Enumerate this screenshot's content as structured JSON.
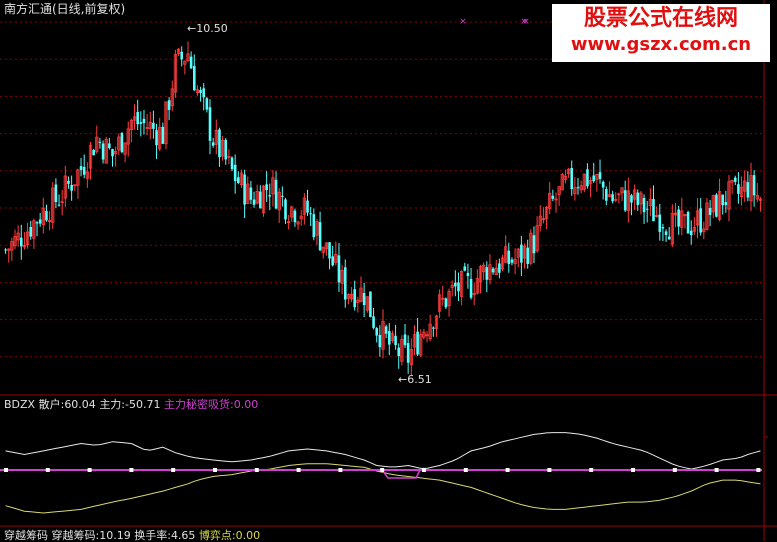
{
  "title": "南方汇通(日线,前复权)",
  "watermark": {
    "line1": "股票公式在线网",
    "line2": "www.gszx.com.cn"
  },
  "price_annotations": {
    "high": "10.50",
    "low": "6.51"
  },
  "indicator": {
    "name": "BDZX",
    "sanhu_label": "散户:",
    "sanhu_value": "60.04",
    "zhuli_label": "主力:",
    "zhuli_value": "-50.71",
    "secret_label": "主力秘密吸货:",
    "secret_value": "0.00"
  },
  "bottom": {
    "item1": "穿越筹码",
    "item2_label": "穿越筹码:",
    "item2_value": "10.19",
    "turnover_label": "换手率:",
    "turnover_value": "4.65",
    "game_label": "博弈点:",
    "game_value": "0.00"
  },
  "colors": {
    "up": "#ff3c3c",
    "down": "#54ffff",
    "white_line": "#e8e8e8",
    "yellow_line": "#d8d870",
    "purple": "#d040d0",
    "grid": "#8b0000",
    "pane_border": "#a00000"
  },
  "chart_data": {
    "type": "candlestick",
    "ylim": [
      6.3,
      10.65
    ],
    "high_marker": 10.5,
    "low_marker": 6.51,
    "close_path": [
      [
        0,
        7.95
      ],
      [
        6,
        8.15
      ],
      [
        12,
        8.4
      ],
      [
        18,
        8.6
      ],
      [
        24,
        8.9
      ],
      [
        29,
        9.25
      ],
      [
        34,
        9.05
      ],
      [
        40,
        9.45
      ],
      [
        45,
        9.4
      ],
      [
        50,
        9.3
      ],
      [
        54,
        10.1
      ],
      [
        58,
        10.25
      ],
      [
        61,
        9.8
      ],
      [
        66,
        9.25
      ],
      [
        72,
        8.85
      ],
      [
        78,
        8.55
      ],
      [
        84,
        8.7
      ],
      [
        90,
        8.45
      ],
      [
        96,
        8.4
      ],
      [
        102,
        7.95
      ],
      [
        108,
        7.5
      ],
      [
        114,
        7.45
      ],
      [
        118,
        7.05
      ],
      [
        123,
        6.8
      ],
      [
        128,
        6.7
      ],
      [
        133,
        7.05
      ],
      [
        138,
        7.3
      ],
      [
        143,
        7.5
      ],
      [
        148,
        7.55
      ],
      [
        153,
        7.75
      ],
      [
        158,
        7.8
      ],
      [
        163,
        7.85
      ],
      [
        168,
        8.05
      ],
      [
        173,
        8.45
      ],
      [
        178,
        8.7
      ],
      [
        183,
        8.8
      ],
      [
        188,
        8.75
      ],
      [
        193,
        8.55
      ],
      [
        198,
        8.55
      ],
      [
        203,
        8.45
      ],
      [
        208,
        8.35
      ],
      [
        213,
        8.2
      ],
      [
        218,
        8.25
      ],
      [
        223,
        8.35
      ],
      [
        228,
        8.55
      ],
      [
        233,
        8.6
      ],
      [
        236,
        8.7
      ],
      [
        240,
        8.55
      ]
    ],
    "white_line_range": [
      20,
      90
    ],
    "white_path": [
      [
        0,
        60
      ],
      [
        6,
        58
      ],
      [
        12,
        60
      ],
      [
        18,
        62
      ],
      [
        24,
        64
      ],
      [
        29,
        63
      ],
      [
        34,
        65
      ],
      [
        40,
        64
      ],
      [
        45,
        60
      ],
      [
        50,
        62
      ],
      [
        54,
        59
      ],
      [
        58,
        57
      ],
      [
        61,
        56
      ],
      [
        66,
        55
      ],
      [
        72,
        54
      ],
      [
        78,
        55
      ],
      [
        84,
        57
      ],
      [
        90,
        60
      ],
      [
        96,
        61
      ],
      [
        102,
        60
      ],
      [
        108,
        58
      ],
      [
        114,
        55
      ],
      [
        118,
        52
      ],
      [
        123,
        51
      ],
      [
        128,
        52
      ],
      [
        133,
        50
      ],
      [
        138,
        52
      ],
      [
        143,
        55
      ],
      [
        148,
        60
      ],
      [
        153,
        62
      ],
      [
        158,
        65
      ],
      [
        163,
        67
      ],
      [
        168,
        69
      ],
      [
        173,
        70
      ],
      [
        178,
        70
      ],
      [
        183,
        69
      ],
      [
        188,
        67
      ],
      [
        193,
        64
      ],
      [
        198,
        62
      ],
      [
        203,
        60
      ],
      [
        208,
        56
      ],
      [
        213,
        52
      ],
      [
        218,
        50
      ],
      [
        223,
        52
      ],
      [
        228,
        55
      ],
      [
        233,
        56
      ],
      [
        236,
        58
      ],
      [
        240,
        60
      ]
    ],
    "yellow_path": [
      [
        0,
        30
      ],
      [
        6,
        27
      ],
      [
        12,
        26
      ],
      [
        18,
        27
      ],
      [
        24,
        28
      ],
      [
        29,
        30
      ],
      [
        34,
        32
      ],
      [
        40,
        34
      ],
      [
        45,
        36
      ],
      [
        50,
        38
      ],
      [
        54,
        40
      ],
      [
        58,
        42
      ],
      [
        61,
        44
      ],
      [
        66,
        46
      ],
      [
        72,
        47
      ],
      [
        78,
        49
      ],
      [
        84,
        50
      ],
      [
        90,
        52
      ],
      [
        96,
        53
      ],
      [
        102,
        53
      ],
      [
        108,
        52
      ],
      [
        114,
        51
      ],
      [
        118,
        49
      ],
      [
        123,
        47
      ],
      [
        128,
        46
      ],
      [
        133,
        45
      ],
      [
        138,
        44
      ],
      [
        143,
        42
      ],
      [
        148,
        40
      ],
      [
        153,
        37
      ],
      [
        158,
        34
      ],
      [
        163,
        31
      ],
      [
        168,
        29
      ],
      [
        173,
        28
      ],
      [
        178,
        28
      ],
      [
        183,
        29
      ],
      [
        188,
        30
      ],
      [
        193,
        31
      ],
      [
        198,
        32
      ],
      [
        203,
        32
      ],
      [
        208,
        33
      ],
      [
        213,
        35
      ],
      [
        218,
        38
      ],
      [
        223,
        42
      ],
      [
        228,
        44
      ],
      [
        233,
        44
      ],
      [
        236,
        43
      ],
      [
        240,
        42
      ]
    ]
  }
}
